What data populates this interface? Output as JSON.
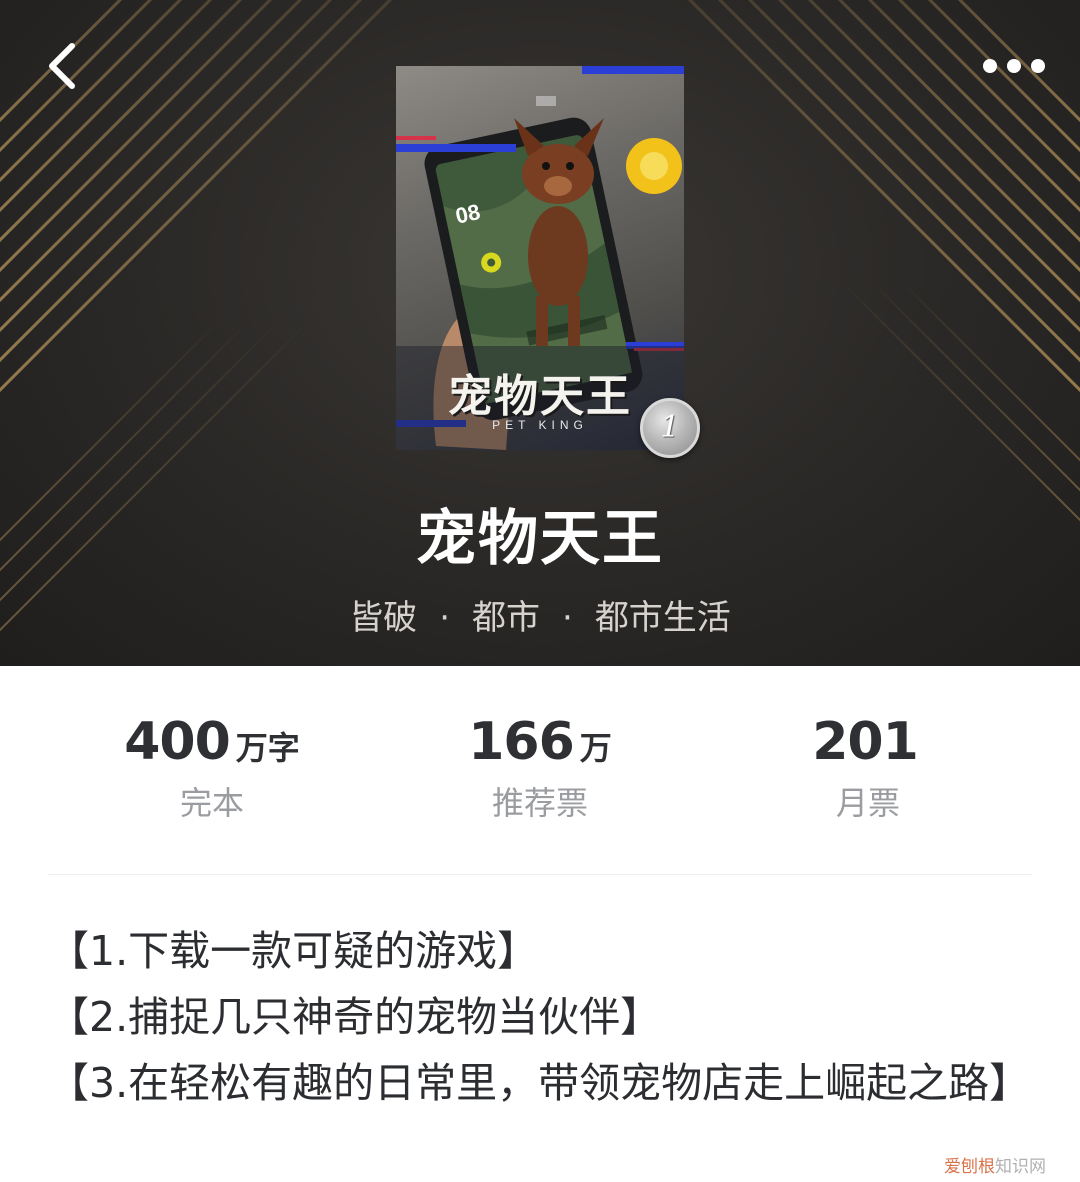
{
  "header": {
    "back_icon": "chevron-left-icon",
    "more_icon": "more-horizontal-icon"
  },
  "cover": {
    "title": "宠物天王",
    "subtitle": "PET KING",
    "rank": "1"
  },
  "book": {
    "title": "宠物天王",
    "author": "皆破",
    "category": "都市",
    "subcategory": "都市生活",
    "separator": "·"
  },
  "stats": [
    {
      "value": "400",
      "unit": "万字",
      "label": "完本"
    },
    {
      "value": "166",
      "unit": "万",
      "label": "推荐票"
    },
    {
      "value": "201",
      "unit": "",
      "label": "月票"
    }
  ],
  "intro": {
    "lines": [
      "【1.下载一款可疑的游戏】",
      "【2.捕捉几只神奇的宠物当伙伴】",
      "【3.在轻松有趣的日常里，带领宠物店走上崛起之路】"
    ]
  },
  "watermark": {
    "brand": "爱刨根",
    "suffix": "知识网"
  },
  "colors": {
    "header_bg": "#2a2826",
    "gold_stripe": "#a88a55",
    "text_dark": "#2e3034",
    "text_muted": "#9a9ca0"
  }
}
